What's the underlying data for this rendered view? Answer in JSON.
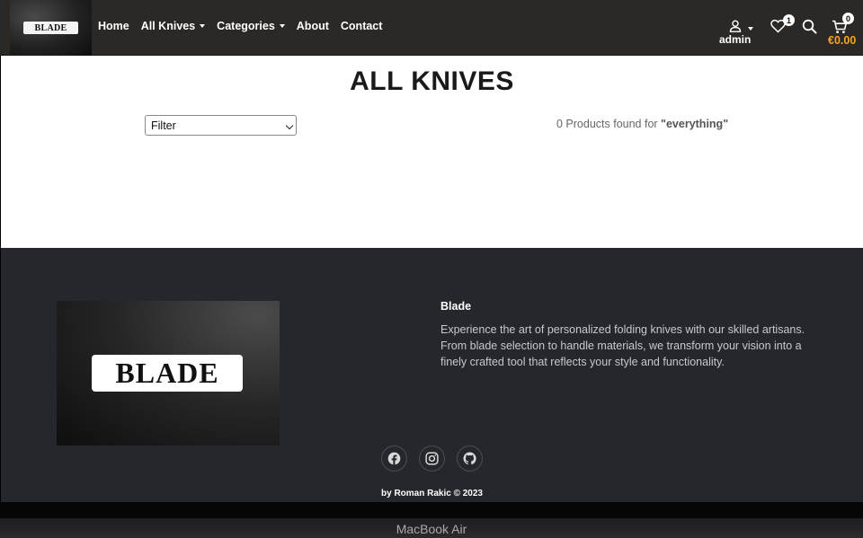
{
  "navbar": {
    "brand": "BLADE",
    "links": [
      {
        "label": "Home",
        "dropdown": false
      },
      {
        "label": "All Knives",
        "dropdown": true
      },
      {
        "label": "Categories",
        "dropdown": true
      },
      {
        "label": "About",
        "dropdown": false
      },
      {
        "label": "Contact",
        "dropdown": false
      }
    ],
    "user": {
      "name": "admin",
      "icon": "user-icon"
    },
    "wishlist": {
      "count": "1",
      "icon": "heart-icon"
    },
    "search": {
      "icon": "search-icon"
    },
    "cart": {
      "count": "0",
      "total": "€0.00",
      "icon": "cart-icon"
    }
  },
  "main": {
    "title": "ALL KNIVES",
    "filter": {
      "selected": "Filter"
    },
    "results": {
      "count_text": "0 Products found for ",
      "query": "\"everything\""
    }
  },
  "footer": {
    "logo_text": "BLADE",
    "title": "Blade",
    "description": "Experience the art of personalized folding knives with our skilled artisans. From blade selection to handle materials, we transform your vision into a finely crafted tool that reflects your style and functionality.",
    "social": [
      {
        "name": "facebook-icon"
      },
      {
        "name": "instagram-icon"
      },
      {
        "name": "github-icon"
      }
    ],
    "copyright": "by Roman Rakic © 2023"
  },
  "device": {
    "label": "MacBook Air"
  },
  "colors": {
    "navbar": "#2b2826",
    "footer": "#25272c",
    "accent": "#f5a623"
  }
}
